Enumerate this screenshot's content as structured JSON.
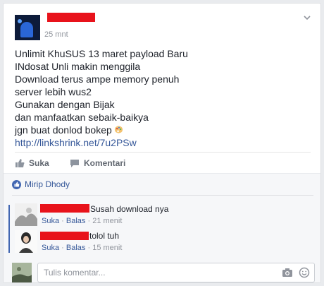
{
  "post": {
    "time": "25 mnt",
    "lines": [
      "Unlimit KhuSUS 13 maret payload Baru",
      "INdosat Unli makin menggila",
      "Download terus ampe memory penuh",
      "server lebih wus2",
      "Gunakan dengan Bijak",
      "dan manfaatkan sebaik-baikya",
      "jgn buat donlod bokep"
    ],
    "link": "http://linkshrink.net/7u2PSw",
    "emoji_icon": "palette-icon"
  },
  "actions": {
    "like_label": "Suka",
    "comment_label": "Komentari"
  },
  "likes": {
    "label": "Mirip Dhody"
  },
  "comments": [
    {
      "text": "Susah download nya",
      "like": "Suka",
      "reply": "Balas",
      "sep": "·",
      "time": "21 menit"
    },
    {
      "text": "tolol tuh",
      "like": "Suka",
      "reply": "Balas",
      "sep": "·",
      "time": "15 menit"
    }
  ],
  "composer": {
    "placeholder": "Tulis komentar..."
  },
  "colors": {
    "link": "#365899",
    "redaction": "#e8131b",
    "like_badge": "#4267b2"
  }
}
